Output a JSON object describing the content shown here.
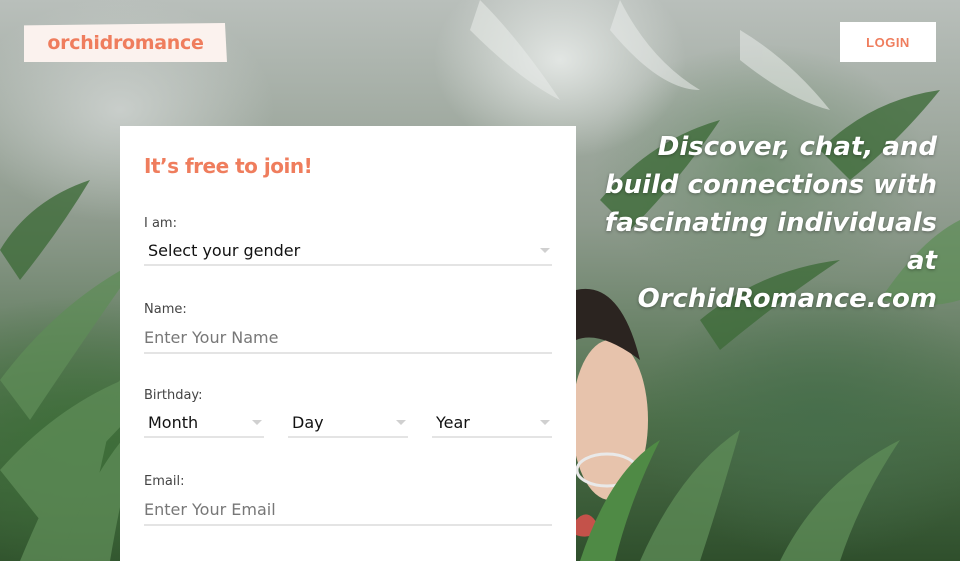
{
  "brand": {
    "logo_text": "orchidromance",
    "accent_color": "#ef7d5d"
  },
  "header": {
    "login_label": "LOGIN"
  },
  "hero": {
    "lines": [
      "Discover, chat, and",
      "build connections with",
      "fascinating individuals",
      "at",
      "OrchidRomance.com"
    ]
  },
  "form": {
    "title": "It’s free to join!",
    "gender": {
      "label": "I am:",
      "value": "Select your gender"
    },
    "name": {
      "label": "Name:",
      "placeholder": "Enter Your Name"
    },
    "birthday": {
      "label": "Birthday:",
      "month": "Month",
      "day": "Day",
      "year": "Year"
    },
    "email": {
      "label": "Email:",
      "placeholder": "Enter Your Email"
    }
  },
  "icons": {
    "dropdown": "chevron-down-icon"
  }
}
